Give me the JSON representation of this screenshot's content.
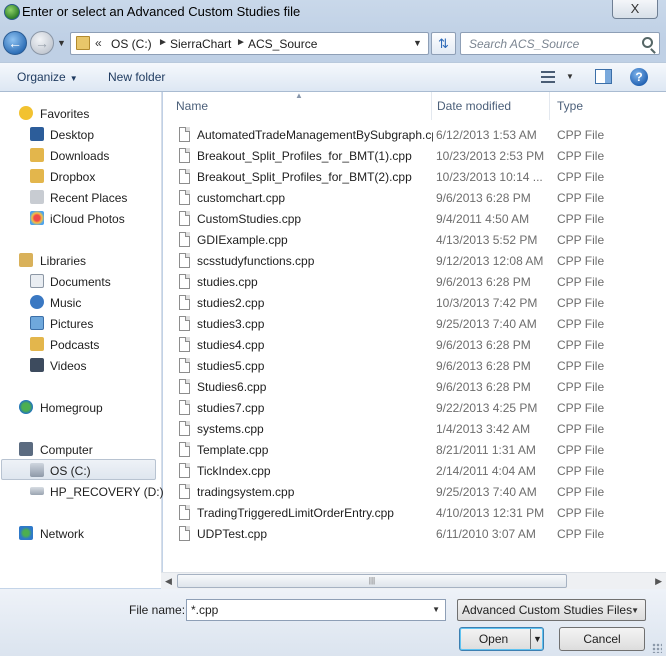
{
  "window": {
    "title": "Enter or select an Advanced Custom Studies file",
    "close_label": "X"
  },
  "address": {
    "crumbs": [
      "OS (C:)",
      "SierraChart",
      "ACS_Source"
    ],
    "overflow": "«",
    "search_placeholder": "Search ACS_Source"
  },
  "toolbar": {
    "organize": "Organize",
    "new_folder": "New folder",
    "help": "?"
  },
  "nav": {
    "favorites": "Favorites",
    "desktop": "Desktop",
    "downloads": "Downloads",
    "dropbox": "Dropbox",
    "recent_places": "Recent Places",
    "icloud_photos": "iCloud Photos",
    "libraries": "Libraries",
    "documents": "Documents",
    "music": "Music",
    "pictures": "Pictures",
    "podcasts": "Podcasts",
    "videos": "Videos",
    "homegroup": "Homegroup",
    "computer": "Computer",
    "os_c": "OS (C:)",
    "hp_recovery": "HP_RECOVERY (D:)",
    "network": "Network"
  },
  "columns": {
    "name": "Name",
    "date_modified": "Date modified",
    "type": "Type"
  },
  "files": [
    {
      "name": "AutomatedTradeManagementBySubgraph.cpp",
      "date": "6/12/2013 1:53 AM",
      "type": "CPP File"
    },
    {
      "name": "Breakout_Split_Profiles_for_BMT(1).cpp",
      "date": "10/23/2013 2:53 PM",
      "type": "CPP File"
    },
    {
      "name": "Breakout_Split_Profiles_for_BMT(2).cpp",
      "date": "10/23/2013 10:14 ...",
      "type": "CPP File"
    },
    {
      "name": "customchart.cpp",
      "date": "9/6/2013 6:28 PM",
      "type": "CPP File"
    },
    {
      "name": "CustomStudies.cpp",
      "date": "9/4/2011 4:50 AM",
      "type": "CPP File"
    },
    {
      "name": "GDIExample.cpp",
      "date": "4/13/2013 5:52 PM",
      "type": "CPP File"
    },
    {
      "name": "scsstudyfunctions.cpp",
      "date": "9/12/2013 12:08 AM",
      "type": "CPP File"
    },
    {
      "name": "studies.cpp",
      "date": "9/6/2013 6:28 PM",
      "type": "CPP File"
    },
    {
      "name": "studies2.cpp",
      "date": "10/3/2013 7:42 PM",
      "type": "CPP File"
    },
    {
      "name": "studies3.cpp",
      "date": "9/25/2013 7:40 AM",
      "type": "CPP File"
    },
    {
      "name": "studies4.cpp",
      "date": "9/6/2013 6:28 PM",
      "type": "CPP File"
    },
    {
      "name": "studies5.cpp",
      "date": "9/6/2013 6:28 PM",
      "type": "CPP File"
    },
    {
      "name": "Studies6.cpp",
      "date": "9/6/2013 6:28 PM",
      "type": "CPP File"
    },
    {
      "name": "studies7.cpp",
      "date": "9/22/2013 4:25 PM",
      "type": "CPP File"
    },
    {
      "name": "systems.cpp",
      "date": "1/4/2013 3:42 AM",
      "type": "CPP File"
    },
    {
      "name": "Template.cpp",
      "date": "8/21/2011 1:31 AM",
      "type": "CPP File"
    },
    {
      "name": "TickIndex.cpp",
      "date": "2/14/2011 4:04 AM",
      "type": "CPP File"
    },
    {
      "name": "tradingsystem.cpp",
      "date": "9/25/2013 7:40 AM",
      "type": "CPP File"
    },
    {
      "name": "TradingTriggeredLimitOrderEntry.cpp",
      "date": "4/10/2013 12:31 PM",
      "type": "CPP File"
    },
    {
      "name": "UDPTest.cpp",
      "date": "6/11/2010 3:07 AM",
      "type": "CPP File"
    }
  ],
  "bottom": {
    "file_name_label": "File name:",
    "file_name_value": "*.cpp",
    "filter_value": "Advanced Custom Studies Files",
    "open_label": "Open",
    "cancel_label": "Cancel"
  }
}
